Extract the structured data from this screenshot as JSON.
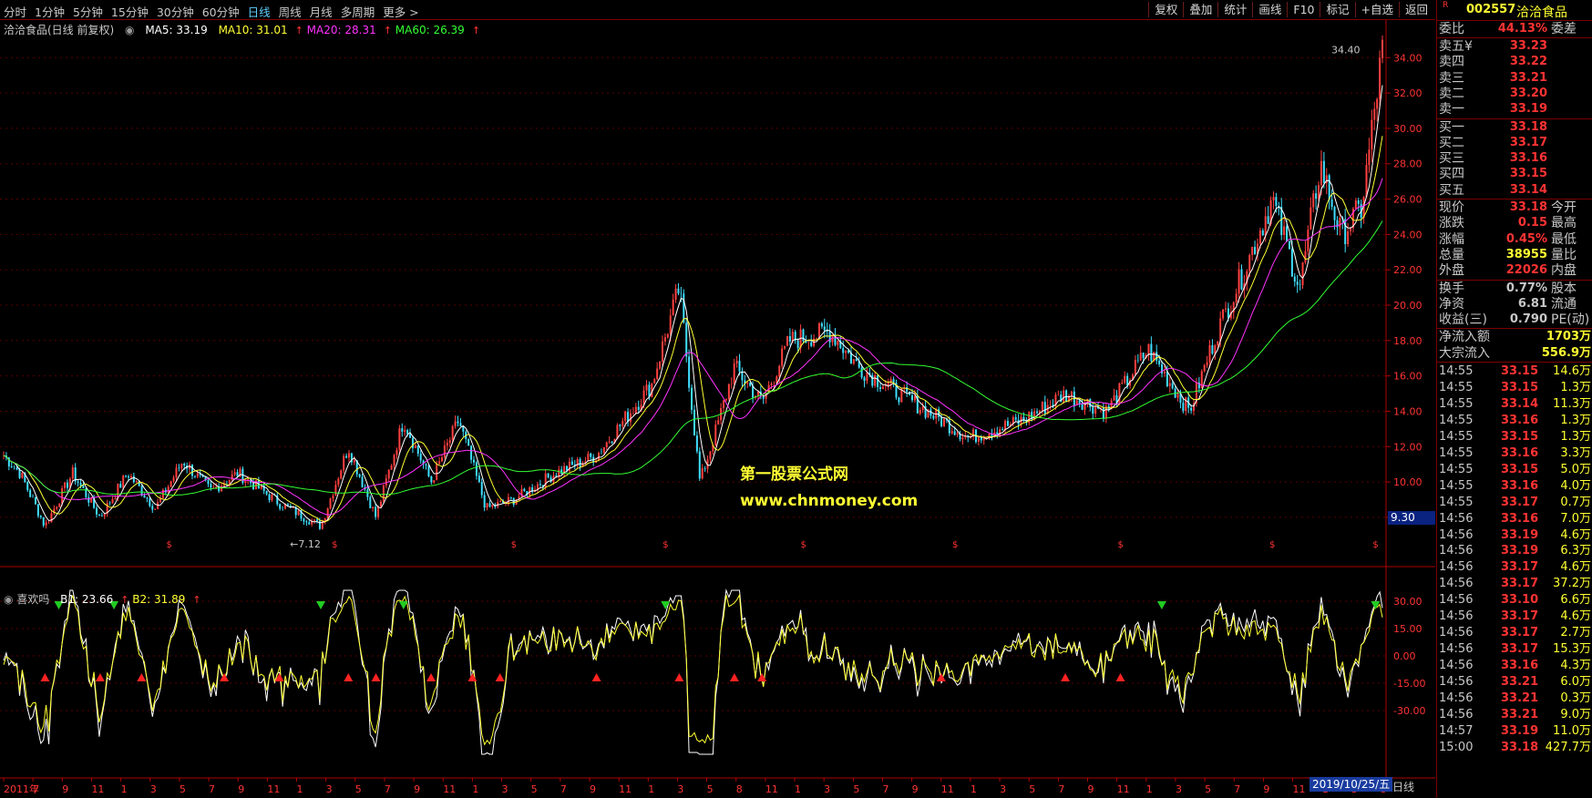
{
  "periods": [
    "分时",
    "1分钟",
    "5分钟",
    "15分钟",
    "30分钟",
    "60分钟",
    "日线",
    "周线",
    "月线",
    "多周期",
    "更多 >"
  ],
  "active_period": "日线",
  "tools": [
    "复权",
    "叠加",
    "统计",
    "画线",
    "F10",
    "标记",
    "+自选",
    "返回"
  ],
  "legend_main": {
    "title": "洽洽食品(日线 前复权)",
    "ma5": "MA5: 33.19",
    "ma10": "MA10: 31.01",
    "ma20": "MA20: 28.31",
    "ma60": "MA60: 26.39",
    "colors": {
      "ma5": "#ffffff",
      "ma10": "#ffff33",
      "ma20": "#ff33ff",
      "ma60": "#33ff33"
    }
  },
  "legend_sub": {
    "title": "喜欢吗",
    "b1": "B1: 23.66",
    "b2": "B2: 31.89"
  },
  "annotations": {
    "high": "34.40",
    "low": "←7.12",
    "last_price": "9.30"
  },
  "watermark": {
    "line1": "第一股票公式网",
    "line2": "www.chnmoney.com"
  },
  "date_bar": {
    "current": "2019/10/25/五",
    "period": "日线"
  },
  "chart_data": [
    {
      "type": "line",
      "name": "main-price",
      "ylim": [
        6.5,
        35.2
      ],
      "yticks": [
        "34.00",
        "32.00",
        "30.00",
        "28.00",
        "26.00",
        "24.00",
        "22.00",
        "20.00",
        "18.00",
        "16.00",
        "14.00",
        "12.00",
        "10.00",
        "8.00"
      ],
      "x_labels": [
        "2011年",
        "7",
        "9",
        "11",
        "1",
        "3",
        "5",
        "7",
        "9",
        "11",
        "1",
        "3",
        "5",
        "7",
        "9",
        "11",
        "1",
        "3",
        "5",
        "7",
        "9",
        "11",
        "1",
        "3",
        "5",
        "8",
        "11",
        "1",
        "3",
        "5",
        "7",
        "9",
        "11",
        "1",
        "3",
        "5",
        "7",
        "9",
        "11",
        "1",
        "3",
        "5",
        "7",
        "9",
        "11",
        "1",
        "3",
        "5"
      ],
      "anchors_t": [
        0,
        0.012,
        0.03,
        0.05,
        0.07,
        0.09,
        0.11,
        0.13,
        0.15,
        0.17,
        0.2,
        0.23,
        0.25,
        0.27,
        0.29,
        0.31,
        0.33,
        0.35,
        0.37,
        0.4,
        0.43,
        0.47,
        0.49,
        0.505,
        0.515,
        0.53,
        0.55,
        0.57,
        0.6,
        0.62,
        0.66,
        0.7,
        0.74,
        0.77,
        0.8,
        0.83,
        0.86,
        0.88,
        0.9,
        0.92,
        0.94,
        0.955,
        0.97,
        0.985,
        1
      ],
      "anchors_v": [
        11.5,
        10.5,
        7.5,
        10.5,
        8.0,
        10.5,
        8.5,
        11.2,
        9.5,
        10.5,
        8.8,
        7.5,
        12.0,
        8.0,
        13.5,
        10.0,
        13.5,
        8.5,
        9.0,
        10.5,
        11.5,
        15.5,
        21.0,
        10.0,
        12.5,
        16.5,
        14.5,
        18.0,
        18.5,
        16.5,
        14.5,
        12.5,
        13.5,
        15.0,
        14.0,
        17.5,
        14.0,
        18.5,
        22.0,
        26.0,
        21.0,
        28.0,
        24.0,
        25.5,
        34.4
      ],
      "signal_marks_t": [
        0.12,
        0.24,
        0.37,
        0.48,
        0.58,
        0.69,
        0.81,
        0.92,
        0.995
      ]
    },
    {
      "type": "line",
      "name": "indicator-xihuanma",
      "ylim": [
        -55,
        40
      ],
      "yticks": [
        "30.00",
        "15.00",
        "0.00",
        "-15.00",
        "-30.00"
      ],
      "series": [
        {
          "name": "B1",
          "color": "#ffffff"
        },
        {
          "name": "B2",
          "color": "#ffff33"
        }
      ],
      "sell_signals_t": [
        0.04,
        0.08,
        0.23,
        0.29,
        0.48,
        0.84,
        0.995
      ],
      "buy_signals_t": [
        0.03,
        0.07,
        0.1,
        0.16,
        0.2,
        0.25,
        0.27,
        0.31,
        0.34,
        0.36,
        0.43,
        0.49,
        0.53,
        0.55,
        0.68,
        0.77,
        0.81
      ],
      "spike_down": {
        "t": 0.5,
        "v": -53
      },
      "spike_up": {
        "t": 0.49,
        "v": 33
      }
    }
  ],
  "quote": {
    "code": "002557",
    "name": "洽洽食品",
    "r_mark": "R",
    "weibi_label": "委比",
    "weibi_value": "44.13%",
    "weicha_label": "委差",
    "asks": [
      {
        "label": "卖五¥",
        "price": "33.23"
      },
      {
        "label": "卖四",
        "price": "33.22"
      },
      {
        "label": "卖三",
        "price": "33.21"
      },
      {
        "label": "卖二",
        "price": "33.20"
      },
      {
        "label": "卖一",
        "price": "33.19"
      }
    ],
    "bids": [
      {
        "label": "买一",
        "price": "33.18"
      },
      {
        "label": "买二",
        "price": "33.17"
      },
      {
        "label": "买三",
        "price": "33.16"
      },
      {
        "label": "买四",
        "price": "33.15"
      },
      {
        "label": "买五",
        "price": "33.14"
      }
    ],
    "stats1": [
      {
        "label": "现价",
        "value": "33.18",
        "right": "今开",
        "color": "#ff3333"
      },
      {
        "label": "涨跌",
        "value": "0.15",
        "right": "最高",
        "color": "#ff3333"
      },
      {
        "label": "涨幅",
        "value": "0.45%",
        "right": "最低",
        "color": "#ff3333"
      },
      {
        "label": "总量",
        "value": "38955",
        "right": "量比",
        "color": "#ffff33"
      },
      {
        "label": "外盘",
        "value": "22026",
        "right": "内盘",
        "color": "#ff3333"
      }
    ],
    "stats2": [
      {
        "label": "换手",
        "value": "0.77%",
        "right": "股本",
        "color": "#c8c8c8"
      },
      {
        "label": "净资",
        "value": "6.81",
        "right": "流通",
        "color": "#c8c8c8"
      },
      {
        "label": "收益(三)",
        "value": "0.790",
        "right": "PE(动)",
        "color": "#c8c8c8"
      }
    ],
    "flows": [
      {
        "label": "净流入额",
        "value": "1703万"
      },
      {
        "label": "大宗流入",
        "value": "556.9万"
      }
    ],
    "ticks": [
      {
        "t": "14:55",
        "p": "33.15",
        "q": "14.6万"
      },
      {
        "t": "14:55",
        "p": "33.15",
        "q": "1.3万"
      },
      {
        "t": "14:55",
        "p": "33.14",
        "q": "11.3万"
      },
      {
        "t": "14:55",
        "p": "33.16",
        "q": "1.3万"
      },
      {
        "t": "14:55",
        "p": "33.15",
        "q": "1.3万"
      },
      {
        "t": "14:55",
        "p": "33.16",
        "q": "3.3万"
      },
      {
        "t": "14:55",
        "p": "33.15",
        "q": "5.0万"
      },
      {
        "t": "14:55",
        "p": "33.16",
        "q": "4.0万"
      },
      {
        "t": "14:55",
        "p": "33.17",
        "q": "0.7万"
      },
      {
        "t": "14:56",
        "p": "33.16",
        "q": "7.0万"
      },
      {
        "t": "14:56",
        "p": "33.19",
        "q": "4.6万"
      },
      {
        "t": "14:56",
        "p": "33.19",
        "q": "6.3万"
      },
      {
        "t": "14:56",
        "p": "33.17",
        "q": "4.6万"
      },
      {
        "t": "14:56",
        "p": "33.17",
        "q": "37.2万"
      },
      {
        "t": "14:56",
        "p": "33.10",
        "q": "6.6万"
      },
      {
        "t": "14:56",
        "p": "33.17",
        "q": "4.6万"
      },
      {
        "t": "14:56",
        "p": "33.17",
        "q": "2.7万"
      },
      {
        "t": "14:56",
        "p": "33.17",
        "q": "15.3万"
      },
      {
        "t": "14:56",
        "p": "33.16",
        "q": "4.3万"
      },
      {
        "t": "14:56",
        "p": "33.21",
        "q": "6.0万"
      },
      {
        "t": "14:56",
        "p": "33.21",
        "q": "0.3万"
      },
      {
        "t": "14:56",
        "p": "33.21",
        "q": "9.0万"
      },
      {
        "t": "14:57",
        "p": "33.19",
        "q": "11.0万"
      },
      {
        "t": "15:00",
        "p": "33.18",
        "q": "427.7万"
      }
    ]
  }
}
